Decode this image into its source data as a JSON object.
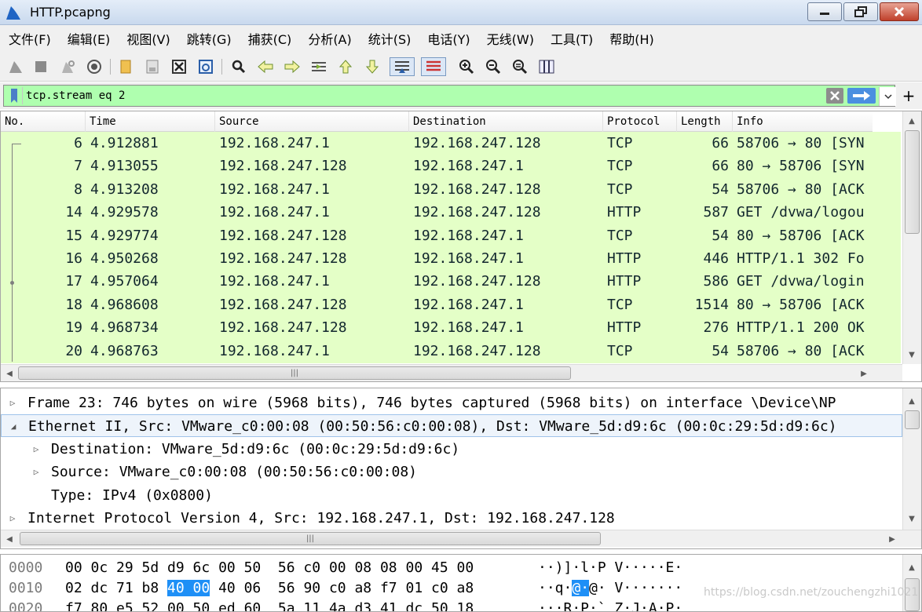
{
  "window": {
    "title": "HTTP.pcapng"
  },
  "menu": [
    "文件(F)",
    "编辑(E)",
    "视图(V)",
    "跳转(G)",
    "捕获(C)",
    "分析(A)",
    "统计(S)",
    "电话(Y)",
    "无线(W)",
    "工具(T)",
    "帮助(H)"
  ],
  "toolbar": {
    "icons": [
      "shark-fin-start-icon",
      "stop-square-icon",
      "restart-fin-icon",
      "capture-options-gear-icon",
      "open-folder-icon",
      "save-file-icon",
      "close-file-icon",
      "reload-icon",
      "find-magnifier-icon",
      "go-back-arrow-icon",
      "go-forward-arrow-icon",
      "go-to-packet-icon",
      "go-first-packet-icon",
      "go-last-packet-icon",
      "autoscroll-icon",
      "colorize-icon",
      "zoom-in-icon",
      "zoom-out-icon",
      "zoom-normal-icon",
      "resize-columns-icon"
    ]
  },
  "filter": {
    "value": "tcp.stream eq 2"
  },
  "packet_list": {
    "columns": [
      "No.",
      "Time",
      "Source",
      "Destination",
      "Protocol",
      "Length",
      "Info"
    ],
    "rows": [
      {
        "no": "6",
        "time": "4.912881",
        "src": "192.168.247.1",
        "dst": "192.168.247.128",
        "proto": "TCP",
        "len": "66",
        "info": "58706 → 80 [SYN"
      },
      {
        "no": "7",
        "time": "4.913055",
        "src": "192.168.247.128",
        "dst": "192.168.247.1",
        "proto": "TCP",
        "len": "66",
        "info": "80 → 58706 [SYN"
      },
      {
        "no": "8",
        "time": "4.913208",
        "src": "192.168.247.1",
        "dst": "192.168.247.128",
        "proto": "TCP",
        "len": "54",
        "info": "58706 → 80 [ACK"
      },
      {
        "no": "14",
        "time": "4.929578",
        "src": "192.168.247.1",
        "dst": "192.168.247.128",
        "proto": "HTTP",
        "len": "587",
        "info": "GET /dvwa/logou"
      },
      {
        "no": "15",
        "time": "4.929774",
        "src": "192.168.247.128",
        "dst": "192.168.247.1",
        "proto": "TCP",
        "len": "54",
        "info": "80 → 58706 [ACK"
      },
      {
        "no": "16",
        "time": "4.950268",
        "src": "192.168.247.128",
        "dst": "192.168.247.1",
        "proto": "HTTP",
        "len": "446",
        "info": "HTTP/1.1 302 Fo"
      },
      {
        "no": "17",
        "time": "4.957064",
        "src": "192.168.247.1",
        "dst": "192.168.247.128",
        "proto": "HTTP",
        "len": "586",
        "info": "GET /dvwa/login"
      },
      {
        "no": "18",
        "time": "4.968608",
        "src": "192.168.247.128",
        "dst": "192.168.247.1",
        "proto": "TCP",
        "len": "1514",
        "info": "80 → 58706 [ACK"
      },
      {
        "no": "19",
        "time": "4.968734",
        "src": "192.168.247.128",
        "dst": "192.168.247.1",
        "proto": "HTTP",
        "len": "276",
        "info": "HTTP/1.1 200 OK"
      },
      {
        "no": "20",
        "time": "4.968763",
        "src": "192.168.247.1",
        "dst": "192.168.247.128",
        "proto": "TCP",
        "len": "54",
        "info": "58706 → 80 [ACK"
      }
    ]
  },
  "packet_details": [
    {
      "text": "Frame 23: 746 bytes on wire (5968 bits), 746 bytes captured (5968 bits) on interface \\Device\\NP",
      "expanded": false,
      "level": 0
    },
    {
      "text": "Ethernet II, Src: VMware_c0:00:08 (00:50:56:c0:00:08), Dst: VMware_5d:d9:6c (00:0c:29:5d:d9:6c)",
      "expanded": true,
      "level": 0
    },
    {
      "text": "Destination: VMware_5d:d9:6c (00:0c:29:5d:d9:6c)",
      "expanded": false,
      "level": 1
    },
    {
      "text": "Source: VMware_c0:00:08 (00:50:56:c0:00:08)",
      "expanded": false,
      "level": 1
    },
    {
      "text": "Type: IPv4 (0x0800)",
      "expanded": null,
      "level": 1
    },
    {
      "text": "Internet Protocol Version 4, Src: 192.168.247.1, Dst: 192.168.247.128",
      "expanded": false,
      "level": 0
    }
  ],
  "bytes": [
    {
      "offset": "0000",
      "hex_a": "00 0c 29 5d d9 6c 00 50  56 c0 00 08 08 00 45 00",
      "hex_hl": "",
      "hex_b": "",
      "ascii_a": "··)]·l·P V·····E·",
      "ascii_hl": "",
      "ascii_b": ""
    },
    {
      "offset": "0010",
      "hex_a": "02 dc 71 b8 ",
      "hex_hl": "40 00",
      "hex_b": " 40 06  56 90 c0 a8 f7 01 c0 a8",
      "ascii_a": "··q·",
      "ascii_hl": "@·",
      "ascii_b": "@· V·······"
    },
    {
      "offset": "0020",
      "hex_a": "f7 80 e5 52 00 50 ed 60  5a 11 4a d3 41 dc 50 18",
      "hex_hl": "",
      "hex_b": "",
      "ascii_a": "···R·P·` Z·J·A·P·",
      "ascii_hl": "",
      "ascii_b": ""
    }
  ],
  "watermark": "https://blog.csdn.net/zouchengzhi1021"
}
